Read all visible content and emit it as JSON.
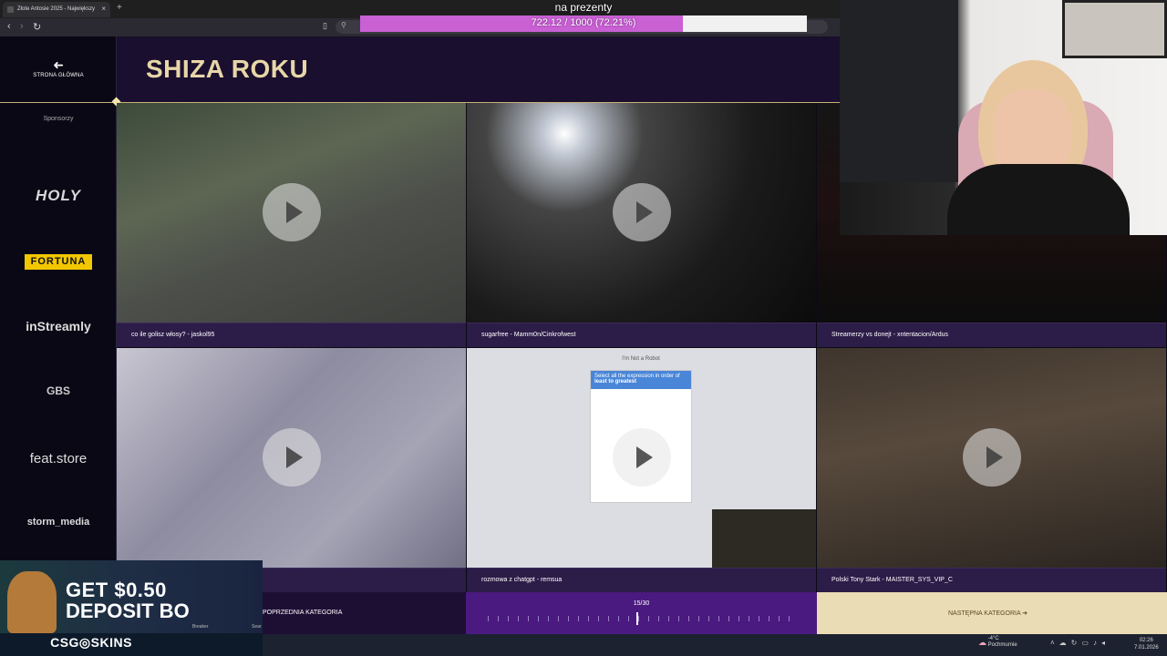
{
  "browser": {
    "tab_title": "Złote Antosie 2025 - Największy",
    "tab_close": "×",
    "new_tab": "+",
    "back": "‹",
    "forward": "›",
    "reload": "↻"
  },
  "donation_goal": {
    "title": "na prezenty",
    "progress_text": "722.12 / 1000 (72.21%)",
    "percent": 72.21,
    "fill_color": "#c960d4"
  },
  "sidebar": {
    "back_label": "STRONA GŁÓWNA",
    "back_arrow": "➜",
    "sponsors_label": "Sponsorzy",
    "sponsors": [
      "HOLY",
      "FORTUNA",
      "inStreamly",
      "GBS",
      "feat.store",
      "storm_media"
    ]
  },
  "header": {
    "title": "SHIZA ROKU"
  },
  "videos": [
    {
      "caption": "co ile golisz włosy? - jaskol95"
    },
    {
      "caption": "sugarfree - Mamm0n/Cinkrofwest"
    },
    {
      "caption": "Streamerzy vs donejt - xntentacion/Ardus"
    },
    {
      "caption": ""
    },
    {
      "caption": "rozmowa z chatgpt - remsua"
    },
    {
      "caption": "Polski Tony Stark - MAISTER_SYS_VIP_C"
    }
  ],
  "captcha": {
    "title": "I'm Not a Robot",
    "prompt": "Select all the expression in order of",
    "sort": "least to greatest"
  },
  "bottom_nav": {
    "prev_label": "POPRZEDNIA KATEGORIA",
    "counter": "15/30",
    "current": 15,
    "total": 30,
    "next_label": "NASTĘPNA KATEGORIA  ➜"
  },
  "ad": {
    "line1": "GET $0.50",
    "line2": "DEPOSIT BO",
    "brand": "CSG◎SKINS",
    "item1": "Breaker",
    "item2": "Sear"
  },
  "taskbar": {
    "temp": "-4°C",
    "weather": "Pochmurnie",
    "time": "02:26",
    "date": "7.01.2026"
  }
}
